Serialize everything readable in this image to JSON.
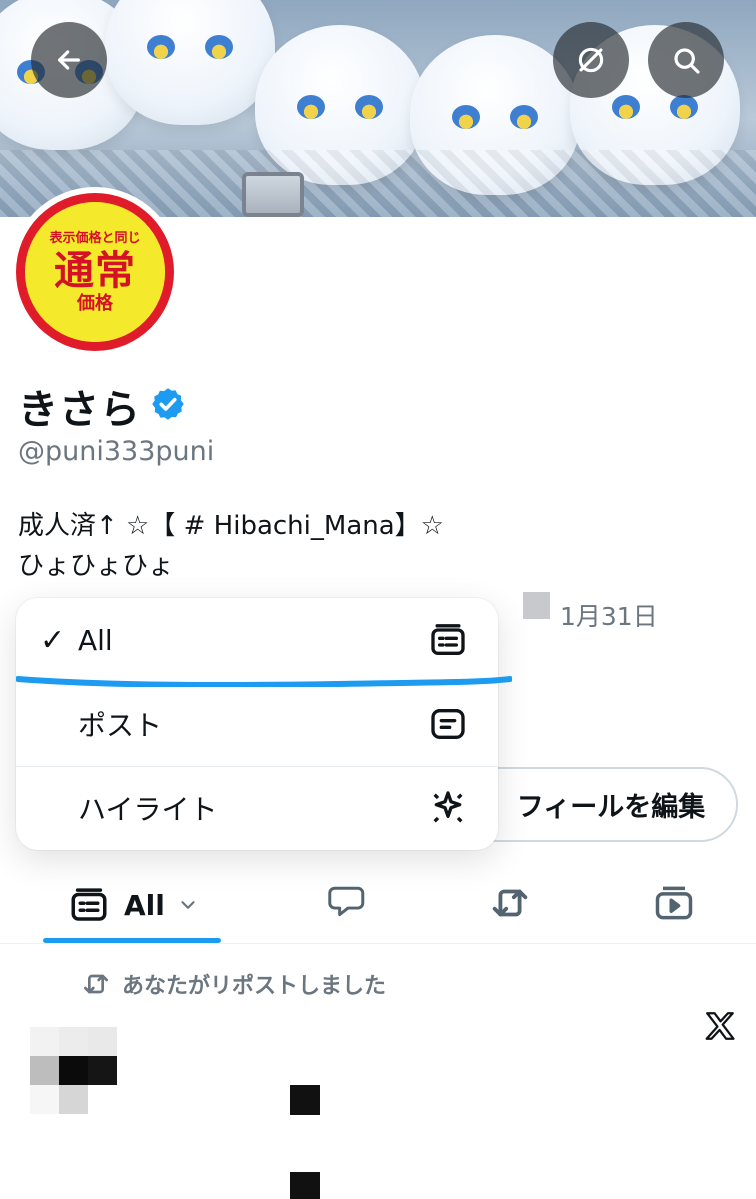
{
  "header": {
    "back_button_label": "back",
    "no_notifications_icon_label": "no-notifications",
    "search_button_label": "search"
  },
  "profile": {
    "display_name": "きさら",
    "handle": "@puni333puni",
    "bio_line1": "成人済↑ ☆【 # Hibachi_Mana】☆",
    "bio_line2": "ひょひょひょ",
    "date_text": "1月31日",
    "edit_button_label": "フィールを編集"
  },
  "avatar_text": {
    "small": "表示価格と同じ",
    "big": "通常",
    "mid": "価格"
  },
  "popup": {
    "items": [
      {
        "label": "All",
        "checked": true,
        "icon": "all-feed-icon"
      },
      {
        "label": "ポスト",
        "checked": false,
        "icon": "post-icon"
      },
      {
        "label": "ハイライト",
        "checked": false,
        "icon": "highlight-icon"
      }
    ],
    "check_mark": "✓"
  },
  "tabs": {
    "active_label": "All",
    "items": [
      "all-tab",
      "replies-tab",
      "reposts-tab",
      "media-tab"
    ]
  },
  "feed": {
    "repost_notice": "あなたがリポストしました"
  },
  "colors": {
    "accent_blue": "#1d9bf0",
    "verified_blue": "#1d9bf0",
    "text_primary": "#0f1419",
    "text_secondary": "#6b7680"
  }
}
